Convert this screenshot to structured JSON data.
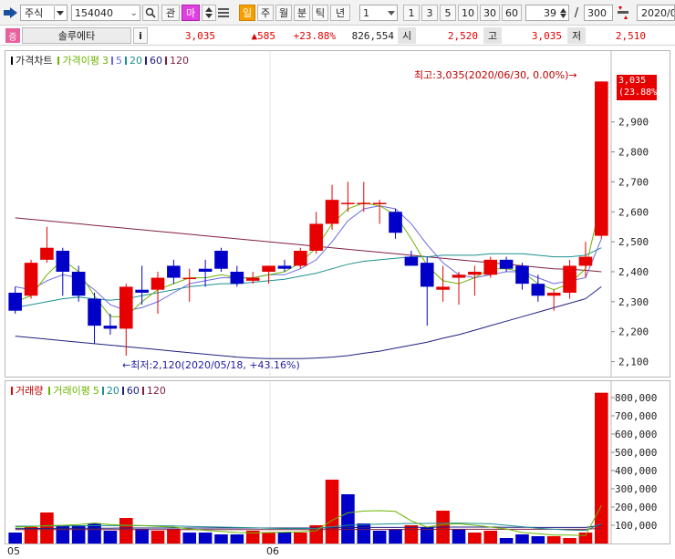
{
  "toolbar": {
    "market": "주식",
    "code": "154040",
    "btn_gwan": "관",
    "btn_ma": "마",
    "btn_il": "일",
    "btn_ju": "주",
    "btn_wol": "월",
    "btn_bun": "분",
    "btn_tick": "틱",
    "btn_nyeon": "년",
    "unit_value": "1",
    "periods": [
      "1",
      "3",
      "5",
      "10",
      "30",
      "60"
    ],
    "count_value": "39",
    "separator": "/",
    "total_value": "300",
    "date_value": "2020/0"
  },
  "quote": {
    "tag": "증",
    "stock_name": "솔루에타",
    "info_icon": "i",
    "price": "3,035",
    "change": "▲585",
    "change_pct": "+23.88%",
    "volume": "826,554",
    "open_label": "시",
    "open": "2,520",
    "high_label": "고",
    "high": "3,035",
    "low_label": "저",
    "low": "2,510"
  },
  "price_panel": {
    "legend_main": "가격차트",
    "legend_ma": "가격이평",
    "legend_periods": [
      "3",
      "5",
      "20",
      "60",
      "120"
    ],
    "high_annotation": "최고:3,035(2020/06/30, 0.00%)→",
    "low_annotation": "←최저:2,120(2020/05/18, +43.16%)",
    "last_price_tag": "3,035",
    "last_pct_tag": "(23.88%)"
  },
  "volume_panel": {
    "legend_main": "거래량",
    "legend_ma": "거래이평",
    "legend_periods": [
      "5",
      "20",
      "60",
      "120"
    ]
  },
  "x_axis": {
    "labels": [
      "05",
      "06"
    ]
  },
  "colors": {
    "up": "#e60000",
    "down": "#0000c8",
    "ma3": "#6cb400",
    "ma5": "#6a6ae0",
    "ma20": "#1e9090",
    "ma60": "#202080",
    "ma120": "#802040"
  },
  "chart_data": [
    {
      "type": "candlestick",
      "title": "가격차트",
      "ylim": [
        2050,
        3100
      ],
      "yticks": [
        2100,
        2200,
        2300,
        2400,
        2500,
        2600,
        2700,
        2800,
        2900
      ],
      "x_labels": [
        "05",
        "06"
      ],
      "candles": [
        {
          "o": 2330,
          "h": 2350,
          "l": 2260,
          "c": 2270
        },
        {
          "o": 2320,
          "h": 2440,
          "l": 2310,
          "c": 2430
        },
        {
          "o": 2440,
          "h": 2550,
          "l": 2430,
          "c": 2480
        },
        {
          "o": 2470,
          "h": 2480,
          "l": 2320,
          "c": 2400
        },
        {
          "o": 2400,
          "h": 2420,
          "l": 2300,
          "c": 2320
        },
        {
          "o": 2310,
          "h": 2330,
          "l": 2160,
          "c": 2220
        },
        {
          "o": 2220,
          "h": 2260,
          "l": 2190,
          "c": 2210
        },
        {
          "o": 2210,
          "h": 2360,
          "l": 2120,
          "c": 2350
        },
        {
          "o": 2340,
          "h": 2420,
          "l": 2290,
          "c": 2330
        },
        {
          "o": 2340,
          "h": 2400,
          "l": 2260,
          "c": 2380
        },
        {
          "o": 2420,
          "h": 2440,
          "l": 2360,
          "c": 2380
        },
        {
          "o": 2380,
          "h": 2410,
          "l": 2300,
          "c": 2380
        },
        {
          "o": 2410,
          "h": 2440,
          "l": 2350,
          "c": 2400
        },
        {
          "o": 2470,
          "h": 2480,
          "l": 2400,
          "c": 2410
        },
        {
          "o": 2400,
          "h": 2420,
          "l": 2350,
          "c": 2360
        },
        {
          "o": 2370,
          "h": 2400,
          "l": 2360,
          "c": 2380
        },
        {
          "o": 2400,
          "h": 2420,
          "l": 2360,
          "c": 2420
        },
        {
          "o": 2420,
          "h": 2440,
          "l": 2400,
          "c": 2410
        },
        {
          "o": 2420,
          "h": 2480,
          "l": 2410,
          "c": 2470
        },
        {
          "o": 2470,
          "h": 2600,
          "l": 2460,
          "c": 2560
        },
        {
          "o": 2560,
          "h": 2690,
          "l": 2540,
          "c": 2640
        },
        {
          "o": 2630,
          "h": 2700,
          "l": 2600,
          "c": 2630
        },
        {
          "o": 2630,
          "h": 2700,
          "l": 2600,
          "c": 2630
        },
        {
          "o": 2630,
          "h": 2640,
          "l": 2560,
          "c": 2630
        },
        {
          "o": 2600,
          "h": 2610,
          "l": 2510,
          "c": 2530
        },
        {
          "o": 2450,
          "h": 2470,
          "l": 2420,
          "c": 2420
        },
        {
          "o": 2430,
          "h": 2450,
          "l": 2220,
          "c": 2350
        },
        {
          "o": 2340,
          "h": 2420,
          "l": 2300,
          "c": 2350
        },
        {
          "o": 2380,
          "h": 2400,
          "l": 2290,
          "c": 2390
        },
        {
          "o": 2390,
          "h": 2420,
          "l": 2320,
          "c": 2400
        },
        {
          "o": 2390,
          "h": 2450,
          "l": 2380,
          "c": 2440
        },
        {
          "o": 2440,
          "h": 2450,
          "l": 2400,
          "c": 2410
        },
        {
          "o": 2420,
          "h": 2430,
          "l": 2340,
          "c": 2360
        },
        {
          "o": 2360,
          "h": 2390,
          "l": 2300,
          "c": 2320
        },
        {
          "o": 2320,
          "h": 2340,
          "l": 2270,
          "c": 2330
        },
        {
          "o": 2330,
          "h": 2440,
          "l": 2310,
          "c": 2420
        },
        {
          "o": 2420,
          "h": 2500,
          "l": 2380,
          "c": 2450
        },
        {
          "o": 2520,
          "h": 3035,
          "l": 2510,
          "c": 3035
        }
      ],
      "ma3": [
        2300,
        2320,
        2390,
        2440,
        2400,
        2320,
        2250,
        2250,
        2300,
        2340,
        2360,
        2380,
        2380,
        2390,
        2380,
        2380,
        2390,
        2400,
        2430,
        2480,
        2560,
        2610,
        2630,
        2620,
        2590,
        2510,
        2420,
        2370,
        2360,
        2380,
        2410,
        2410,
        2400,
        2360,
        2340,
        2360,
        2410,
        2640
      ],
      "ma5": [
        2350,
        2340,
        2370,
        2390,
        2380,
        2340,
        2290,
        2270,
        2280,
        2300,
        2330,
        2360,
        2370,
        2380,
        2380,
        2380,
        2390,
        2390,
        2410,
        2440,
        2500,
        2570,
        2610,
        2620,
        2610,
        2560,
        2490,
        2430,
        2390,
        2380,
        2390,
        2400,
        2400,
        2380,
        2360,
        2370,
        2380,
        2510
      ],
      "ma20": [
        2280,
        2290,
        2300,
        2310,
        2315,
        2310,
        2305,
        2310,
        2320,
        2330,
        2340,
        2350,
        2355,
        2360,
        2360,
        2365,
        2370,
        2375,
        2385,
        2395,
        2410,
        2425,
        2435,
        2440,
        2445,
        2450,
        2450,
        2455,
        2455,
        2455,
        2460,
        2460,
        2460,
        2455,
        2450,
        2450,
        2455,
        2480
      ],
      "ma60": [
        2185,
        2180,
        2175,
        2170,
        2165,
        2160,
        2155,
        2150,
        2145,
        2140,
        2135,
        2130,
        2125,
        2120,
        2115,
        2112,
        2110,
        2110,
        2110,
        2112,
        2115,
        2120,
        2128,
        2135,
        2145,
        2155,
        2165,
        2178,
        2190,
        2205,
        2220,
        2235,
        2250,
        2265,
        2280,
        2295,
        2310,
        2350
      ],
      "ma120": [
        2580,
        2575,
        2570,
        2565,
        2560,
        2555,
        2550,
        2545,
        2540,
        2535,
        2530,
        2525,
        2520,
        2515,
        2510,
        2505,
        2500,
        2495,
        2490,
        2485,
        2480,
        2475,
        2470,
        2465,
        2460,
        2455,
        2450,
        2445,
        2440,
        2435,
        2430,
        2425,
        2420,
        2415,
        2410,
        2408,
        2405,
        2400
      ]
    },
    {
      "type": "bar",
      "title": "거래량",
      "ylim": [
        0,
        850000
      ],
      "yticks": [
        100000,
        200000,
        300000,
        400000,
        500000,
        600000,
        700000,
        800000
      ],
      "values": [
        60000,
        90000,
        170000,
        100000,
        100000,
        110000,
        70000,
        140000,
        80000,
        70000,
        80000,
        60000,
        60000,
        50000,
        50000,
        70000,
        60000,
        60000,
        60000,
        100000,
        350000,
        270000,
        110000,
        70000,
        80000,
        100000,
        90000,
        180000,
        80000,
        60000,
        70000,
        30000,
        50000,
        40000,
        40000,
        30000,
        60000,
        826554
      ],
      "up": [
        false,
        true,
        true,
        false,
        false,
        false,
        false,
        true,
        false,
        true,
        true,
        false,
        false,
        false,
        false,
        true,
        true,
        false,
        true,
        true,
        true,
        false,
        false,
        false,
        false,
        true,
        false,
        true,
        false,
        true,
        true,
        false,
        false,
        false,
        true,
        true,
        true,
        true
      ],
      "ma5": [
        90000,
        92000,
        98000,
        100000,
        104000,
        112000,
        104000,
        100000,
        98000,
        94000,
        90000,
        80000,
        72000,
        66000,
        60000,
        58000,
        60000,
        62000,
        64000,
        70000,
        128000,
        168000,
        178000,
        180000,
        176000,
        124000,
        90000,
        104000,
        108000,
        100000,
        90000,
        80000,
        60000,
        54000,
        46000,
        46000,
        44000,
        208000
      ],
      "ma20": [
        95000,
        95000,
        96000,
        96000,
        97000,
        98000,
        98000,
        99000,
        98000,
        97000,
        96000,
        94000,
        92000,
        90000,
        88000,
        86000,
        84000,
        82000,
        82000,
        83000,
        92000,
        100000,
        104000,
        106000,
        108000,
        110000,
        110000,
        112000,
        112000,
        110000,
        108000,
        100000,
        92000,
        84000,
        78000,
        74000,
        72000,
        108000
      ],
      "ma60": [
        82000,
        82000,
        83000,
        83000,
        84000,
        84000,
        84000,
        85000,
        85000,
        85000,
        85000,
        85000,
        85000,
        85000,
        85000,
        85000,
        85000,
        85000,
        85000,
        85000,
        86000,
        87000,
        88000,
        88000,
        88000,
        89000,
        89000,
        90000,
        90000,
        90000,
        90000,
        89000,
        89000,
        88000,
        88000,
        88000,
        88000,
        100000
      ],
      "ma120": [
        76000,
        76000,
        76000,
        76000,
        76000,
        76000,
        76000,
        76000,
        76000,
        76000,
        76000,
        76000,
        76000,
        76000,
        76000,
        76000,
        76000,
        76000,
        76000,
        76000,
        77000,
        77000,
        77000,
        77000,
        77000,
        77000,
        77000,
        78000,
        78000,
        78000,
        78000,
        78000,
        78000,
        78000,
        78000,
        78000,
        78000,
        84000
      ]
    }
  ]
}
